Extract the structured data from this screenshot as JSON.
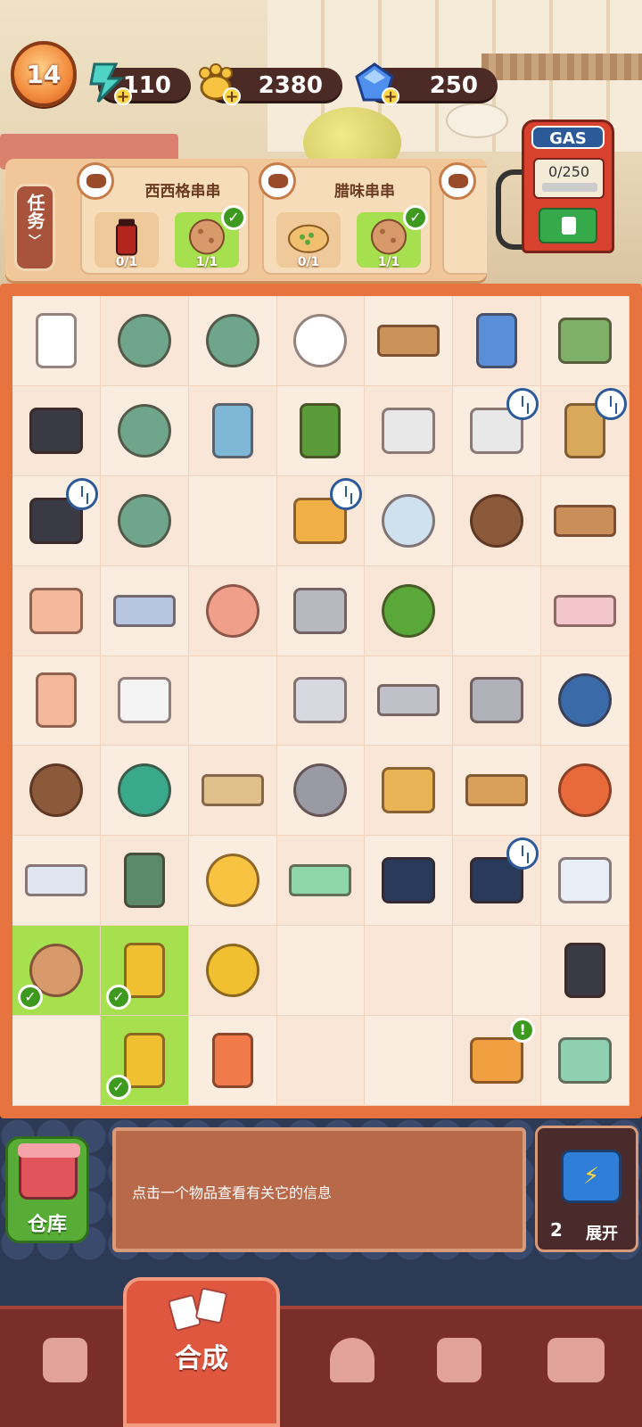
{
  "player": {
    "level": "14"
  },
  "resources": {
    "energy": "110",
    "paws": "2380",
    "gems": "250"
  },
  "tasks": {
    "tab_label": "任务",
    "orders": [
      {
        "name": "西西格串串",
        "slots": [
          {
            "count": "0/1",
            "done": false,
            "item": "chili-sauce-jar"
          },
          {
            "count": "1/1",
            "done": true,
            "item": "meatball"
          }
        ]
      },
      {
        "name": "腊味串串",
        "slots": [
          {
            "count": "0/1",
            "done": false,
            "item": "scallion-cake"
          },
          {
            "count": "1/1",
            "done": true,
            "item": "meatball"
          }
        ]
      }
    ]
  },
  "gas": {
    "title": "GAS",
    "value": "0/250"
  },
  "board": {
    "cells": [
      "chef-hat",
      "skewer-pot",
      "skewer-pot-2",
      "cloud-locked",
      "spice-rack",
      "notebook",
      "delivery-scooter",
      "seaweed-rolls",
      "hotpot",
      "fridge",
      "bonsai-tree",
      "toaster",
      "printer",
      "hand-truck-boxes",
      "seaweed-rolls-2",
      "hotpot-2",
      "",
      "skewer-menu",
      "shell-planter",
      "skewer-plate",
      "fried-dough",
      "paper-envelope",
      "paper-stack",
      "crumpled-paper",
      "metal-ingots",
      "tea-leaf",
      "",
      "towel",
      "folded-paper",
      "sugar-cubes",
      "",
      "paint-box",
      "metal-bar",
      "metal-bars",
      "noodle-bowl",
      "skewer-plate-2",
      "scissors",
      "peanut-bag",
      "screw",
      "paper-bag",
      "cutting-board-greens",
      "shrimp-bowl",
      "paper-sheets",
      "hand-truck",
      "paw-coin",
      "ruler",
      "ink-bottle",
      "ink-bottle-2",
      "medicine-bottles",
      "meatball",
      "pliers",
      "tape-measure",
      "",
      "",
      "",
      "medicine-bottle",
      "",
      "pliers-2",
      "amber-gem",
      "",
      "",
      "treasure-chest",
      "storage-chest"
    ],
    "highlighted": [
      49,
      50,
      57
    ],
    "timers": [
      12,
      13,
      14,
      17,
      47
    ],
    "alerts": [
      61
    ]
  },
  "info": {
    "storage_label": "仓库",
    "message": "点击一个物品查看有关它的信息",
    "expand_count": "2",
    "expand_label": "展开"
  },
  "nav": {
    "active_label": "合成"
  },
  "colors": {
    "board_frame": "#e7743e",
    "highlight": "#a7e04f",
    "check": "#3e9a1f"
  }
}
